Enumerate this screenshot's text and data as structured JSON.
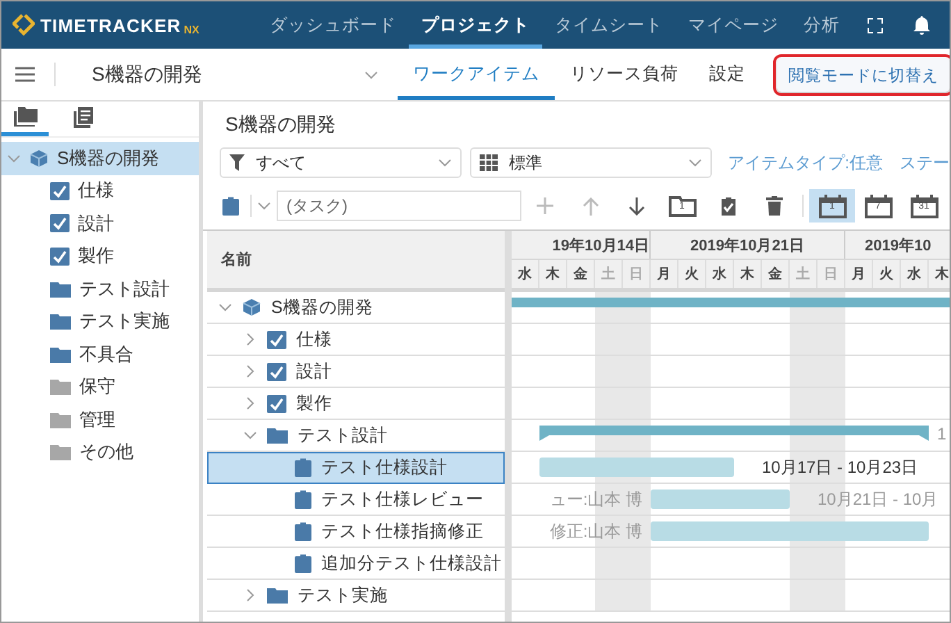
{
  "topbar": {
    "logo": {
      "name": "TIMETRACKER",
      "suffix": "NX"
    },
    "nav": [
      {
        "label": "ダッシュボード",
        "selected": false
      },
      {
        "label": "プロジェクト",
        "selected": true
      },
      {
        "label": "タイムシート",
        "selected": false
      },
      {
        "label": "マイページ",
        "selected": false
      },
      {
        "label": "分析",
        "selected": false
      }
    ]
  },
  "subbar": {
    "project": "S機器の開発",
    "tabs": [
      {
        "label": "ワークアイテム",
        "selected": true
      },
      {
        "label": "リソース負荷",
        "selected": false
      },
      {
        "label": "設定",
        "selected": false
      }
    ],
    "mode_button": {
      "label": "閲覧モードに切替え",
      "highlighted": true
    }
  },
  "sidebar": {
    "tabs": [
      {
        "kind": "folders",
        "selected": true
      },
      {
        "kind": "list",
        "selected": false
      }
    ],
    "tree": [
      {
        "label": "S機器の開発",
        "kind": "project",
        "expanded": true,
        "selected": true,
        "children": [
          {
            "label": "仕様",
            "kind": "checklist",
            "selected": false
          },
          {
            "label": "設計",
            "kind": "checklist",
            "selected": false
          },
          {
            "label": "製作",
            "kind": "checklist",
            "selected": false
          },
          {
            "label": "テスト設計",
            "kind": "folder",
            "selected": false
          },
          {
            "label": "テスト実施",
            "kind": "folder",
            "selected": false
          },
          {
            "label": "不具合",
            "kind": "folder",
            "selected": false
          },
          {
            "label": "保守",
            "kind": "inactive-folder",
            "selected": false
          },
          {
            "label": "管理",
            "kind": "inactive-folder",
            "selected": false
          },
          {
            "label": "その他",
            "kind": "inactive-folder",
            "selected": false
          }
        ]
      }
    ]
  },
  "main": {
    "title": "S機器の開発",
    "filter": "すべて",
    "view": "標準",
    "links": [
      "アイテムタイプ:任意",
      "ステー"
    ],
    "task_field": {
      "placeholder": "(タスク)"
    },
    "folder_button_label": "1",
    "scale_buttons": [
      {
        "label": "1",
        "selected": true
      },
      {
        "label": "7",
        "selected": false
      },
      {
        "label": "31",
        "selected": false
      }
    ]
  },
  "grid": {
    "columns": [
      {
        "label": "名前"
      }
    ],
    "weeks": [
      "19年10月14日",
      "2019年10月21日",
      "2019年10"
    ],
    "days": [
      {
        "label": "水",
        "weekend": false
      },
      {
        "label": "木",
        "weekend": false
      },
      {
        "label": "金",
        "weekend": false
      },
      {
        "label": "土",
        "weekend": true
      },
      {
        "label": "日",
        "weekend": true
      },
      {
        "label": "月",
        "weekend": false
      },
      {
        "label": "火",
        "weekend": false
      },
      {
        "label": "水",
        "weekend": false
      },
      {
        "label": "木",
        "weekend": false
      },
      {
        "label": "金",
        "weekend": false
      },
      {
        "label": "土",
        "weekend": true
      },
      {
        "label": "日",
        "weekend": true
      },
      {
        "label": "月",
        "weekend": false
      },
      {
        "label": "火",
        "weekend": false
      },
      {
        "label": "水",
        "weekend": false
      },
      {
        "label": "木",
        "weekend": false
      }
    ],
    "rows": [
      {
        "label": "S機器の開発",
        "kind": "project",
        "expanded": true,
        "selected": false,
        "bar": {
          "kind": "summary"
        },
        "children": [
          {
            "label": "仕様",
            "kind": "checklist",
            "expanded": false,
            "selected": false
          },
          {
            "label": "設計",
            "kind": "checklist",
            "expanded": false,
            "selected": false
          },
          {
            "label": "製作",
            "kind": "checklist",
            "expanded": false,
            "selected": false
          },
          {
            "label": "テスト設計",
            "kind": "folder",
            "expanded": true,
            "selected": false,
            "bar": {
              "kind": "summary",
              "caption": "1"
            },
            "children": [
              {
                "label": "テスト仕様設計",
                "kind": "task",
                "selected": true,
                "bar": {
                  "kind": "task",
                  "caption": "10月17日 - 10月23日"
                }
              },
              {
                "label": "テスト仕様レビュー",
                "kind": "task",
                "selected": false,
                "bar": {
                  "kind": "task",
                  "caption": "10月21日 - 10月",
                  "assignee": "ュー:山本 博"
                }
              },
              {
                "label": "テスト仕様指摘修正",
                "kind": "task",
                "selected": false,
                "bar": {
                  "kind": "task",
                  "assignee": "修正:山本 博"
                }
              },
              {
                "label": "追加分テスト仕様設計",
                "kind": "task",
                "selected": false
              }
            ]
          },
          {
            "label": "テスト実施",
            "kind": "folder",
            "expanded": false,
            "selected": false
          }
        ]
      }
    ]
  }
}
